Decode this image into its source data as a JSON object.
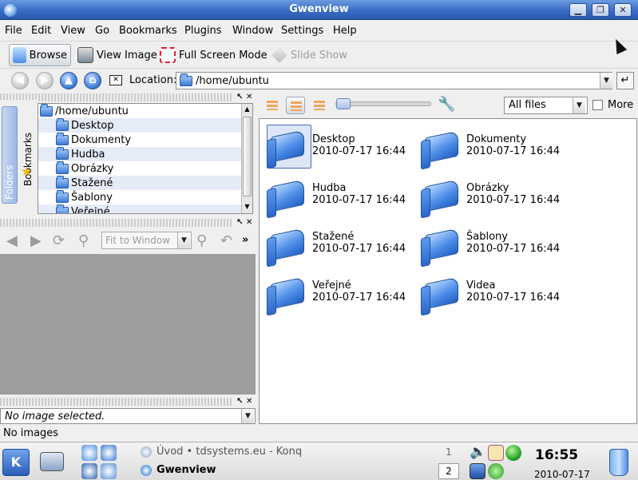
{
  "window": {
    "title": "Gwenview",
    "icons": {
      "app": "gwenview-app-icon",
      "minimize": "minimize-icon",
      "maximize": "maximize-icon",
      "close": "close-icon"
    }
  },
  "menu": {
    "items": [
      {
        "label": "File"
      },
      {
        "label": "Edit"
      },
      {
        "label": "View"
      },
      {
        "label": "Go"
      },
      {
        "label": "Bookmarks"
      },
      {
        "label": "Plugins"
      },
      {
        "label": "Window"
      },
      {
        "label": "Settings"
      },
      {
        "label": "Help"
      }
    ]
  },
  "toolbar": {
    "browse": "Browse",
    "view_image": "View Image",
    "full_screen": "Full Screen Mode",
    "slide_show": "Slide Show"
  },
  "location": {
    "label": "Location:",
    "value": "/home/ubuntu"
  },
  "sidetabs": {
    "folders": "Folders",
    "bookmarks": "Bookmarks"
  },
  "tree": {
    "root": "/home/ubuntu",
    "items": [
      {
        "label": "Desktop"
      },
      {
        "label": "Dokumenty"
      },
      {
        "label": "Hudba"
      },
      {
        "label": "Obrázky"
      },
      {
        "label": "Stažené"
      },
      {
        "label": "Šablony"
      },
      {
        "label": "Veřejné"
      }
    ]
  },
  "viewer": {
    "zoom_placeholder": "Fit to Window",
    "image_selection": "No image selected."
  },
  "browser": {
    "filter": "All files",
    "more_label": "More",
    "files": [
      {
        "name": "Desktop",
        "date": "2010-07-17 16:44"
      },
      {
        "name": "Dokumenty",
        "date": "2010-07-17 16:44"
      },
      {
        "name": "Hudba",
        "date": "2010-07-17 16:44"
      },
      {
        "name": "Obrázky",
        "date": "2010-07-17 16:44"
      },
      {
        "name": "Stažené",
        "date": "2010-07-17 16:44"
      },
      {
        "name": "Šablony",
        "date": "2010-07-17 16:44"
      },
      {
        "name": "Veřejné",
        "date": "2010-07-17 16:44"
      },
      {
        "name": "Videa",
        "date": "2010-07-17 16:44"
      }
    ]
  },
  "status": "No images",
  "taskbar": {
    "tasks": [
      {
        "label": "Úvod • tdsystems.eu - Konq"
      },
      {
        "label": "Gwenview"
      }
    ],
    "pager": [
      "1",
      "2"
    ],
    "clock": "16:55",
    "date": "2010-07-17"
  }
}
